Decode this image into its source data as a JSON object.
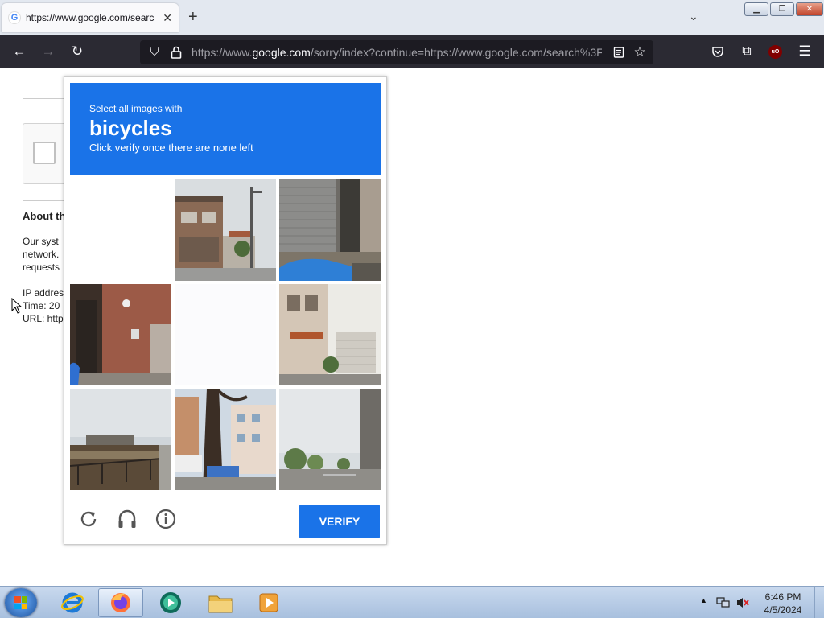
{
  "browser": {
    "tab_title": "https://www.google.com/search",
    "tab_favicon": "G",
    "url_prefix": "https://www.",
    "url_domain": "google.com",
    "url_suffix": "/sorry/index?continue=https://www.google.com/search%3F..."
  },
  "page": {
    "about_heading": "About th",
    "line1": "Our syst",
    "line2": "network.",
    "line3": "requests",
    "ip_label": "IP addres",
    "time_label": "Time: 20",
    "url_label": "URL: http"
  },
  "captcha": {
    "instruction_small": "Select all images with",
    "target": "bicycles",
    "instruction_sub": "Click verify once there are none left",
    "verify_label": "VERIFY",
    "tiles": [
      {
        "id": 1,
        "scene": "blank"
      },
      {
        "id": 2,
        "scene": "street-house-pole"
      },
      {
        "id": 3,
        "scene": "garage-shutter-car"
      },
      {
        "id": 4,
        "scene": "brick-entrance"
      },
      {
        "id": 5,
        "scene": "blank"
      },
      {
        "id": 6,
        "scene": "houses-street"
      },
      {
        "id": 7,
        "scene": "riverside-railing"
      },
      {
        "id": 8,
        "scene": "tree-buildings-bus"
      },
      {
        "id": 9,
        "scene": "road-sky-trees"
      }
    ]
  },
  "taskbar": {
    "clock_time": "6:46 PM",
    "clock_date": "4/5/2024"
  },
  "colors": {
    "captcha_blue": "#1a73e8",
    "toolbar_dark": "#2b2a33",
    "taskbar": "#b8cce6"
  }
}
